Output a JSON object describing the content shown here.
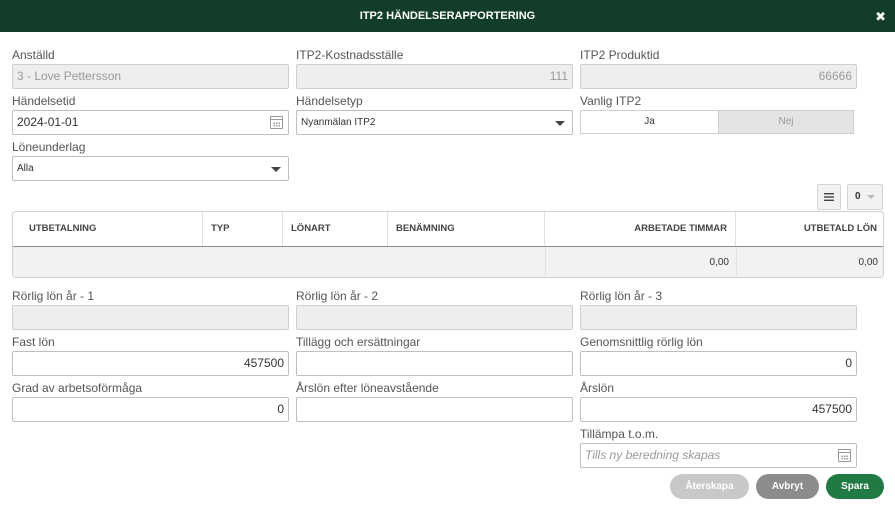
{
  "dialog": {
    "title": "ITP2 HÄNDELSERAPPORTERING",
    "close_glyph": "✖"
  },
  "fields": {
    "anstalld": {
      "label": "Anställd",
      "value": "3 - Love Pettersson"
    },
    "kostnadsstalle": {
      "label": "ITP2-Kostnadsställe",
      "value": "111"
    },
    "produktid": {
      "label": "ITP2 Produktid",
      "value": "66666"
    },
    "handelsetid": {
      "label": "Händelsetid",
      "value": "2024-01-01"
    },
    "handelsetyp": {
      "label": "Händelsetyp",
      "value": "Nyanmälan ITP2"
    },
    "vanlig_itp2": {
      "label": "Vanlig ITP2",
      "options": [
        "Ja",
        "Nej"
      ],
      "selected": "Ja"
    },
    "loneunderlag": {
      "label": "Löneunderlag",
      "value": "Alla"
    },
    "rorlig1": {
      "label": "Rörlig lön år - 1",
      "value": ""
    },
    "rorlig2": {
      "label": "Rörlig lön år - 2",
      "value": ""
    },
    "rorlig3": {
      "label": "Rörlig lön år - 3",
      "value": ""
    },
    "fast_lon": {
      "label": "Fast lön",
      "value": "457500"
    },
    "tillagg": {
      "label": "Tillägg och ersättningar",
      "value": ""
    },
    "genomsnitt": {
      "label": "Genomsnittlig rörlig lön",
      "value": "0"
    },
    "grad": {
      "label": "Grad av arbetsoförmåga",
      "value": "0"
    },
    "arslon_efter": {
      "label": "Årslön efter löneavstående",
      "value": ""
    },
    "arslon": {
      "label": "Årslön",
      "value": "457500"
    },
    "tillampa": {
      "label": "Tillämpa t.o.m.",
      "placeholder": "Tills ny beredning skapas"
    }
  },
  "table_toolbar": {
    "menu_icon": "hamburger-menu-icon",
    "page_size": "0"
  },
  "table": {
    "columns": [
      "UTBETALNING",
      "TYP",
      "LÖNART",
      "BENÄMNING",
      "ARBETADE TIMMAR",
      "UTBETALD LÖN"
    ],
    "totals": {
      "arbetade_timmar": "0,00",
      "utbetald_lon": "0,00"
    }
  },
  "buttons": {
    "aterskapa": "Återskapa",
    "avbryt": "Avbryt",
    "spara": "Spara"
  },
  "colors": {
    "header_bg": "#123d2a",
    "primary": "#1f7a43",
    "secondary": "#8c8c8c",
    "disabled": "#c8c8c8"
  }
}
